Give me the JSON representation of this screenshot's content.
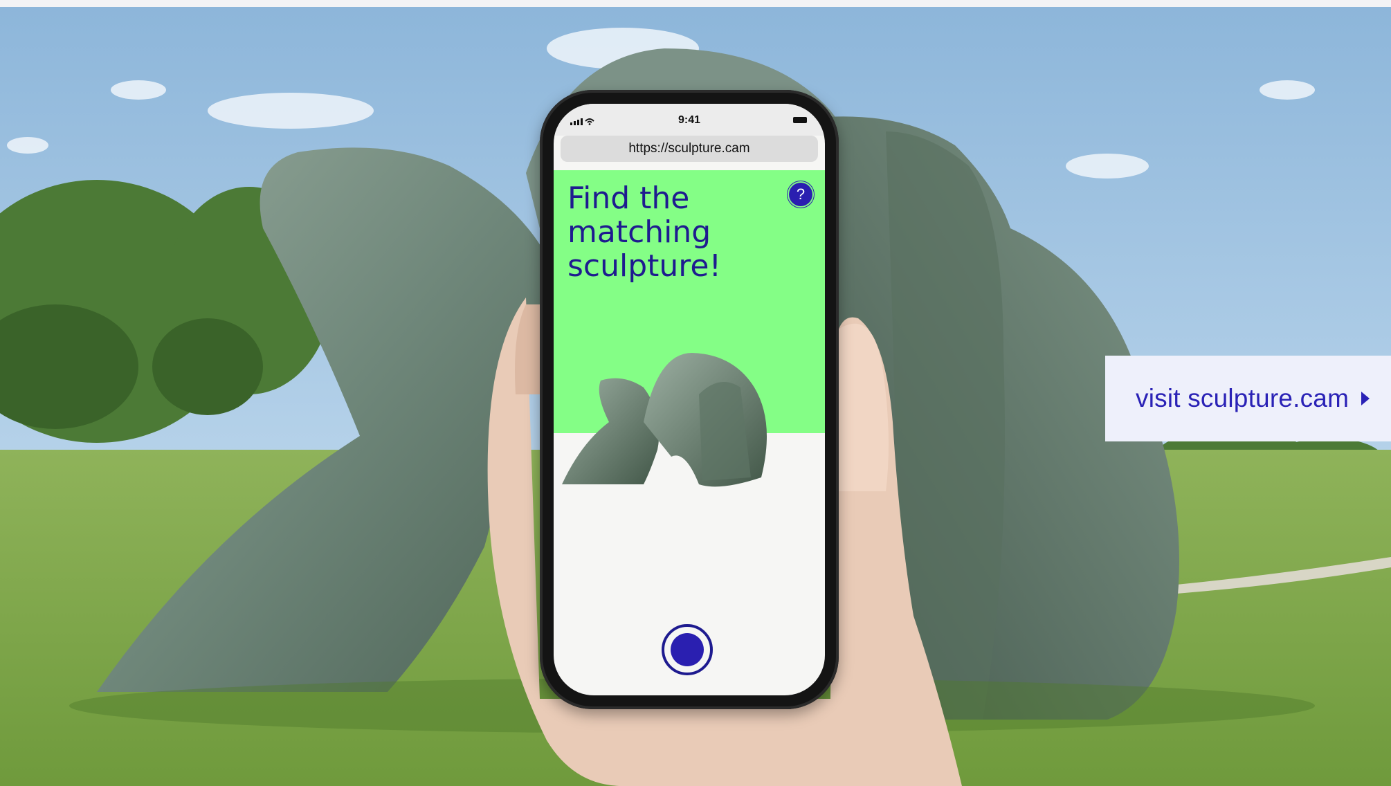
{
  "phone": {
    "status_time": "9:41",
    "url": "https://sculpture.cam",
    "headline_lines": [
      "Find the",
      "matching",
      "sculpture!"
    ],
    "help_label": "?"
  },
  "visit_link": {
    "label": "visit sculpture.cam",
    "icon": "chevron-right-icon"
  },
  "colors": {
    "accent": "#2a1fb0",
    "green": "#84fe86",
    "panel": "#eef0fb"
  }
}
